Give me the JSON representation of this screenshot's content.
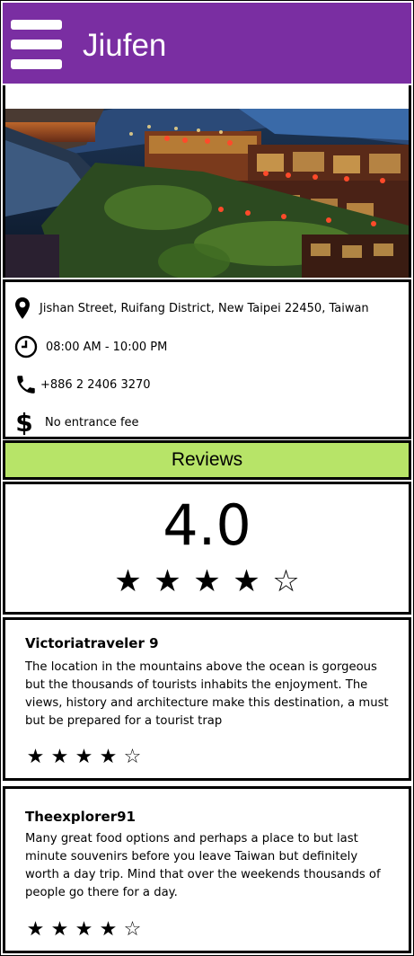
{
  "header": {
    "title": "Jiufen",
    "menu_icon": "hamburger-menu-icon",
    "background": "#7a2ea2"
  },
  "info": {
    "address": "Jishan Street, Ruifang District, New Taipei 22450, Taiwan",
    "hours": "08:00 AM - 10:00 PM",
    "phone": "+886 2 2406 3270",
    "fee": "No entrance fee"
  },
  "reviews_section": {
    "label": "Reviews",
    "background": "#b7e468"
  },
  "rating": {
    "value": "4.0",
    "stars": 4,
    "max": 5
  },
  "reviews": [
    {
      "user": "Victoriatraveler 9",
      "text": "The location in the mountains above the ocean is gorgeous but the thousands of tourists inhabits the enjoyment. The views, history and architecture make this destination, a must but be prepared for a tourist trap",
      "stars": 4
    },
    {
      "user": "Theexplorer91",
      "text": "Many great food options and perhaps a place to but last minute souvenirs before you leave Taiwan but definitely worth a day trip. Mind that over the weekends thousands of people go there for a day.",
      "stars": 4
    }
  ]
}
